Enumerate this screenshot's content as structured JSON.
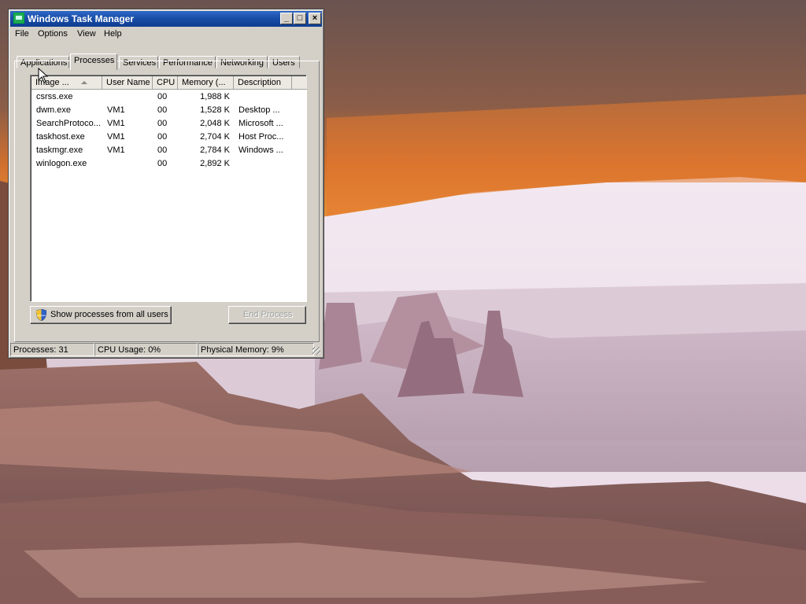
{
  "window": {
    "title": "Windows Task Manager",
    "controls": {
      "minimize": "_",
      "maximize": "□",
      "close": "×"
    }
  },
  "menu": [
    "File",
    "Options",
    "View",
    "Help"
  ],
  "tabs": [
    {
      "label": "Applications",
      "active": false
    },
    {
      "label": "Processes",
      "active": true
    },
    {
      "label": "Services",
      "active": false
    },
    {
      "label": "Performance",
      "active": false
    },
    {
      "label": "Networking",
      "active": false
    },
    {
      "label": "Users",
      "active": false
    }
  ],
  "table": {
    "columns": [
      "Image ...",
      "User Name",
      "CPU",
      "Memory (...",
      "Description"
    ],
    "rows": [
      {
        "name": "csrss.exe",
        "user": "",
        "cpu": "00",
        "memory": "1,988 K",
        "description": ""
      },
      {
        "name": "dwm.exe",
        "user": "VM1",
        "cpu": "00",
        "memory": "1,528 K",
        "description": "Desktop ..."
      },
      {
        "name": "SearchProtoco...",
        "user": "VM1",
        "cpu": "00",
        "memory": "2,048 K",
        "description": "Microsoft ..."
      },
      {
        "name": "taskhost.exe",
        "user": "VM1",
        "cpu": "00",
        "memory": "2,704 K",
        "description": "Host Proc..."
      },
      {
        "name": "taskmgr.exe",
        "user": "VM1",
        "cpu": "00",
        "memory": "2,784 K",
        "description": "Windows ..."
      },
      {
        "name": "winlogon.exe",
        "user": "",
        "cpu": "00",
        "memory": "2,892 K",
        "description": ""
      }
    ]
  },
  "buttons": {
    "show_all": "Show processes from all users",
    "end_process": "End Process"
  },
  "status": {
    "processes": "Processes: 31",
    "cpu": "CPU Usage: 0%",
    "memory": "Physical Memory: 9%"
  },
  "icons": {
    "app": "task-manager-icon",
    "shield": "uac-shield-icon",
    "cursor": "mouse-pointer-icon"
  }
}
